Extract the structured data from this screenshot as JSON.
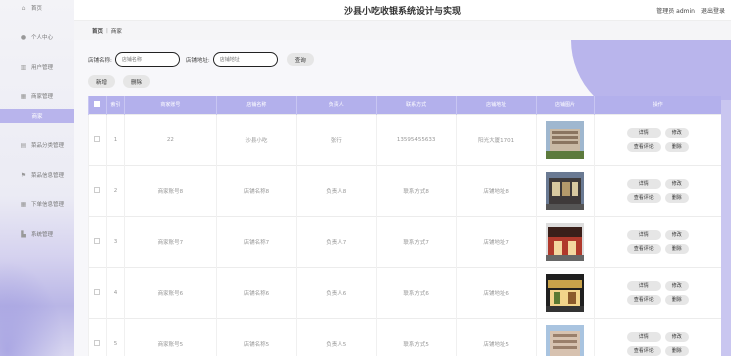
{
  "header": {
    "title": "沙县小吃收银系统设计与实现",
    "user": "管理员 admin",
    "logout": "退出登录"
  },
  "sidebar": {
    "items": [
      {
        "label": "首页",
        "icon": "home-icon",
        "glyph": "⌂"
      },
      {
        "label": "个人中心",
        "icon": "user-icon",
        "glyph": "●"
      },
      {
        "label": "用户管理",
        "icon": "building-icon",
        "glyph": "▥"
      },
      {
        "label": "商家管理",
        "icon": "grid-icon",
        "glyph": "▦"
      },
      {
        "label": "商家",
        "icon": "",
        "glyph": ""
      },
      {
        "label": "菜品分类管理",
        "icon": "list-icon",
        "glyph": "▤"
      },
      {
        "label": "菜品信息管理",
        "icon": "flag-icon",
        "glyph": "⚑"
      },
      {
        "label": "下单信息管理",
        "icon": "grid-icon",
        "glyph": "▦"
      },
      {
        "label": "系统管理",
        "icon": "chart-icon",
        "glyph": "▙"
      }
    ]
  },
  "breadcrumb": {
    "home": "首页",
    "sep": "|",
    "current": "商家"
  },
  "search": {
    "name_label": "店铺名称:",
    "name_placeholder": "店铺名称",
    "addr_label": "店铺地址:",
    "addr_placeholder": "店铺地址",
    "query": "查询"
  },
  "toolbar": {
    "add": "新增",
    "delete": "删除"
  },
  "table": {
    "headers": [
      "",
      "索引",
      "商家账号",
      "店铺名称",
      "负责人",
      "联系方式",
      "店铺地址",
      "店铺图片",
      "操作"
    ],
    "rows": [
      {
        "index": "1",
        "account": "22",
        "shop": "沙县小吃",
        "owner": "张行",
        "phone": "13595455633",
        "addr": "阳光大厦1701"
      },
      {
        "index": "2",
        "account": "商家账号8",
        "shop": "店铺名称8",
        "owner": "负责人8",
        "phone": "联系方式8",
        "addr": "店铺地址8"
      },
      {
        "index": "3",
        "account": "商家账号7",
        "shop": "店铺名称7",
        "owner": "负责人7",
        "phone": "联系方式7",
        "addr": "店铺地址7"
      },
      {
        "index": "4",
        "account": "商家账号6",
        "shop": "店铺名称6",
        "owner": "负责人6",
        "phone": "联系方式6",
        "addr": "店铺地址6"
      },
      {
        "index": "5",
        "account": "商家账号5",
        "shop": "店铺名称5",
        "owner": "负责人5",
        "phone": "联系方式5",
        "addr": "店铺地址5"
      }
    ],
    "op_labels": {
      "detail": "详情",
      "edit": "修改",
      "review": "查看评论",
      "delete": "删除"
    }
  },
  "colors": {
    "accent": "#b3b0ec",
    "button": "#e6e6e6"
  }
}
